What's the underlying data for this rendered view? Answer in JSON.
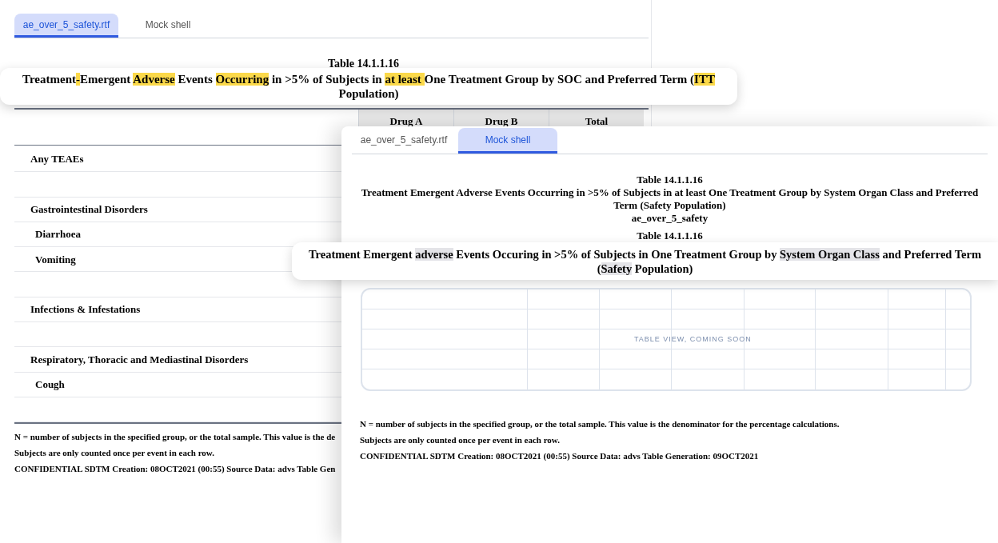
{
  "back_panel": {
    "tabs": [
      {
        "label": "ae_over_5_safety.rtf",
        "selected": true
      },
      {
        "label": "Mock shell",
        "selected": false
      }
    ],
    "table_number": "Table 14.1.1.16",
    "title_callout": {
      "lines": [
        [
          {
            "text": "Treatment",
            "highlighted": false
          },
          {
            "text": "-",
            "highlighted": true
          },
          {
            "text": "Emergent ",
            "highlighted": false
          },
          {
            "text": "Adverse",
            "highlighted": true
          },
          {
            "text": " Events ",
            "highlighted": false
          },
          {
            "text": "Occurring",
            "highlighted": true
          },
          {
            "text": " in >5% of Subjects in ",
            "highlighted": false
          },
          {
            "text": "at least ",
            "highlighted": true
          },
          {
            "text": "One Treatment Group by SOC and Preferred Term (",
            "highlighted": false
          },
          {
            "text": "ITT",
            "highlighted": true
          }
        ],
        [
          {
            "text": "Population)",
            "highlighted": false
          }
        ]
      ]
    },
    "table": {
      "columns": [
        "Drug A",
        "Drug B",
        "Total"
      ],
      "rows": [
        {
          "kind": "category",
          "label": "Any TEAEs"
        },
        {
          "kind": "blank"
        },
        {
          "kind": "category",
          "label": "Gastrointestinal Disorders"
        },
        {
          "kind": "term",
          "label": "Diarrhoea"
        },
        {
          "kind": "term",
          "label": "Vomiting"
        },
        {
          "kind": "blank"
        },
        {
          "kind": "category",
          "label": "Infections & Infestations"
        },
        {
          "kind": "blank"
        },
        {
          "kind": "category",
          "label": "Respiratory, Thoracic and Mediastinal Disorders"
        },
        {
          "kind": "term",
          "label": "Cough"
        },
        {
          "kind": "blank"
        }
      ]
    },
    "footnotes": [
      "N = number of subjects in the specified group, or the total sample. This value is the de",
      "Subjects are only counted once per event in each row.",
      "CONFIDENTIAL SDTM Creation: 08OCT2021 (00:55) Source Data: advs Table Gen"
    ]
  },
  "front_panel": {
    "tabs": [
      {
        "label": "ae_over_5_safety.rtf",
        "selected": false
      },
      {
        "label": "Mock shell",
        "selected": true
      }
    ],
    "table_number": "Table 14.1.1.16",
    "title_lines": [
      "Treatment Emergent Adverse Events Occurring in >5% of Subjects in at least One Treatment Group by System Organ Class and Preferred",
      "Term (Safety Population)"
    ],
    "subtitle": "ae_over_5_safety",
    "table_number_2": "Table 14.1.1.16",
    "title_callout": {
      "lines": [
        [
          {
            "text": "Treatment Emergent ",
            "highlighted": false
          },
          {
            "text": "adverse",
            "highlighted": true
          },
          {
            "text": " Events Occuring in >5% of Subjects in One Treatment Group by ",
            "highlighted": false
          },
          {
            "text": "System Organ Class",
            "highlighted": true
          },
          {
            "text": " and Preferred Term",
            "highlighted": false
          }
        ],
        [
          {
            "text": "(",
            "highlighted": false
          },
          {
            "text": "Safety",
            "highlighted": true
          },
          {
            "text": " Population)",
            "highlighted": false
          }
        ]
      ]
    },
    "placeholder": "TABLE VIEW, COMING SOON",
    "footnotes": [
      "N = number of subjects in the specified group, or the total sample. This value is the denominator for the percentage calculations.",
      "Subjects are only counted once per event in each row.",
      "CONFIDENTIAL SDTM Creation: 08OCT2021 (00:55) Source Data: advs Table Generation: 09OCT2021"
    ]
  }
}
